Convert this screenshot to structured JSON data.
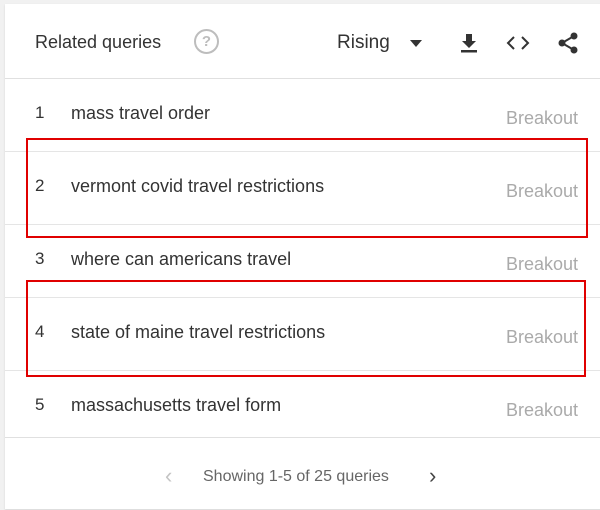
{
  "header": {
    "title": "Related queries",
    "help_icon": "?",
    "sort_select": {
      "selected": "Rising"
    }
  },
  "icons": {
    "help": "help-icon",
    "dropdown": "caret-down-icon",
    "download": "download-icon",
    "embed": "code-icon",
    "share": "share-icon",
    "prev": "chevron-left-icon",
    "next": "chevron-right-icon"
  },
  "queries": [
    {
      "rank": "1",
      "query": "mass travel order",
      "value": "Breakout"
    },
    {
      "rank": "2",
      "query": "vermont covid travel restrictions",
      "value": "Breakout"
    },
    {
      "rank": "3",
      "query": "where can americans travel",
      "value": "Breakout"
    },
    {
      "rank": "4",
      "query": "state of maine travel restrictions",
      "value": "Breakout"
    },
    {
      "rank": "5",
      "query": "massachusetts travel form",
      "value": "Breakout"
    }
  ],
  "footer": {
    "prev": "‹",
    "pagination_text": "Showing 1-5 of 25 queries",
    "next": "›"
  },
  "colors": {
    "highlight": "#e00000",
    "muted_value": "#aaaaaa",
    "text": "#333333"
  }
}
